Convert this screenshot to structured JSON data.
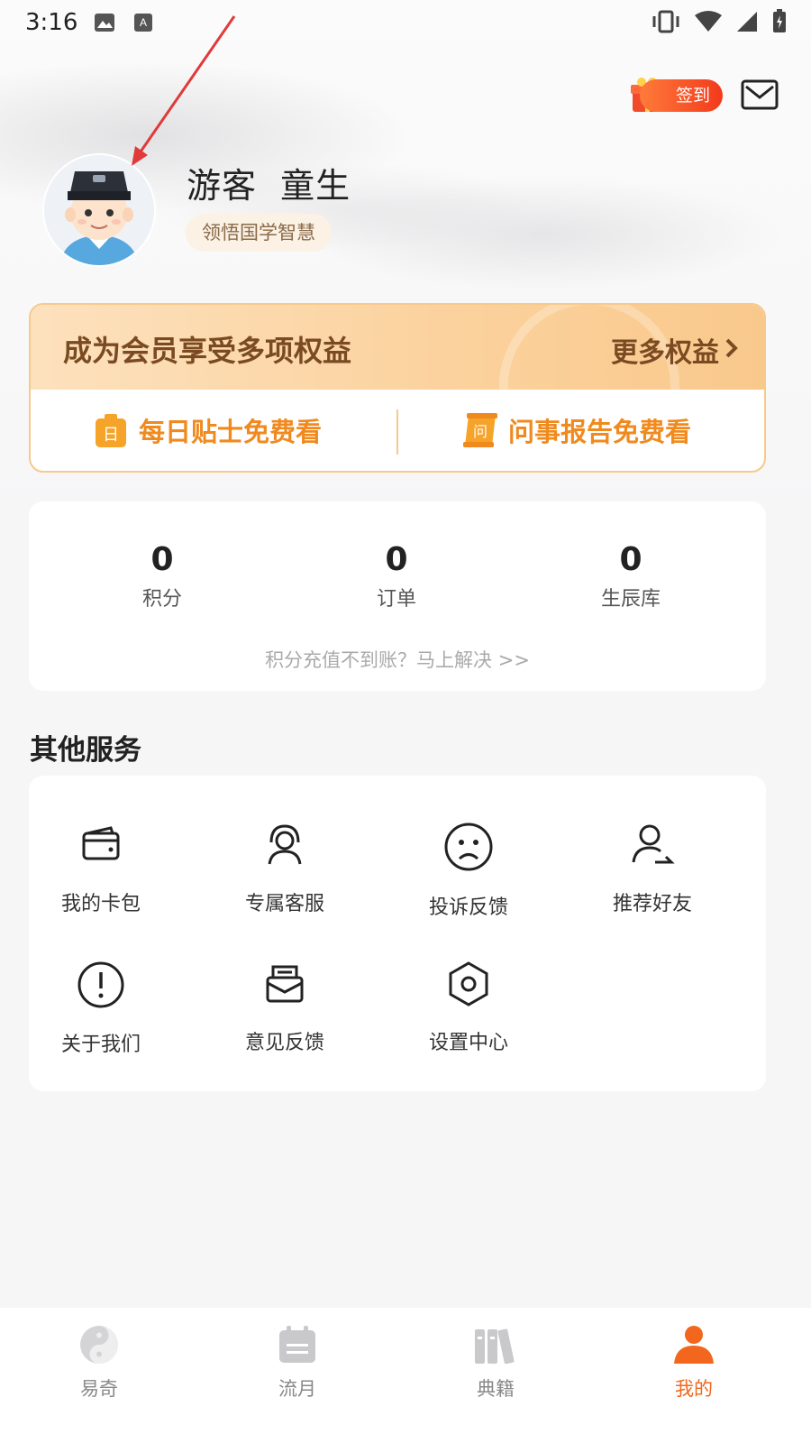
{
  "status_bar": {
    "time": "3:16"
  },
  "header": {
    "checkin_label": "签到",
    "username": "游客  童生",
    "tagline": "领悟国学智慧"
  },
  "member_card": {
    "title": "成为会员享受多项权益",
    "more_label": "更多权益",
    "perks": [
      "每日贴士免费看",
      "问事报告免费看"
    ]
  },
  "stats": {
    "items": [
      {
        "value": "0",
        "label": "积分"
      },
      {
        "value": "0",
        "label": "订单"
      },
      {
        "value": "0",
        "label": "生辰库"
      }
    ],
    "hint": "积分充值不到账？马上解决 >>"
  },
  "services": {
    "title": "其他服务",
    "items": [
      {
        "label": "我的卡包",
        "icon": "wallet-icon"
      },
      {
        "label": "专属客服",
        "icon": "headset-icon"
      },
      {
        "label": "投诉反馈",
        "icon": "sad-face-icon"
      },
      {
        "label": "推荐好友",
        "icon": "share-user-icon"
      },
      {
        "label": "关于我们",
        "icon": "exclamation-icon"
      },
      {
        "label": "意见反馈",
        "icon": "feedback-mail-icon"
      },
      {
        "label": "设置中心",
        "icon": "settings-hex-icon"
      }
    ]
  },
  "bottom_nav": {
    "tabs": [
      {
        "label": "易奇",
        "icon": "yinyang-icon"
      },
      {
        "label": "流月",
        "icon": "calendar-icon"
      },
      {
        "label": "典籍",
        "icon": "books-icon"
      },
      {
        "label": "我的",
        "icon": "person-icon"
      }
    ],
    "active": "我的"
  },
  "colors": {
    "accent": "#f2671d",
    "member_text": "#7a4a22",
    "perk_text": "#f08a1e"
  }
}
